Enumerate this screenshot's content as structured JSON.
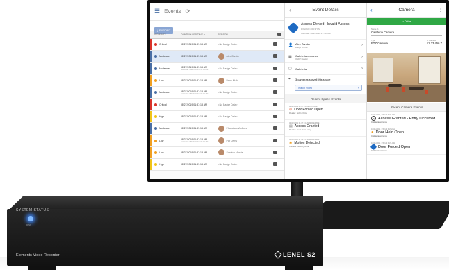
{
  "events_pane": {
    "title": "Events",
    "export_label": "EXPORT",
    "columns": [
      "SEVERITY",
      "CONTROLLER TIME",
      "PERSON",
      ""
    ],
    "rows": [
      {
        "severity": "Critical",
        "color": "#d9342b",
        "time": "08/27/2019 01:37:13 AM",
        "sub": "",
        "person": "<No Badge Data>",
        "avatar": false
      },
      {
        "severity": "Moderate",
        "color": "#4a6fa5",
        "time": "08/27/2019 01:37:13 AM",
        "sub": "",
        "person": "Alec Zander",
        "avatar": true
      },
      {
        "severity": "Moderate",
        "color": "#4a6fa5",
        "time": "08/27/2019 01:37:13 AM",
        "sub": "Controller: 08/27/2019 1:37:06 AM",
        "person": "<No Badge Data>",
        "avatar": false
      },
      {
        "severity": "Low",
        "color": "#f0a023",
        "time": "08/27/2019 01:37:13 AM",
        "sub": "",
        "person": "Brian Muth",
        "avatar": true
      },
      {
        "severity": "Moderate",
        "color": "#4a6fa5",
        "time": "08/27/2019 01:37:13 AM",
        "sub": "Controller: 08/27/2019 1:37:06 AM",
        "person": "<No Badge Data>",
        "avatar": false
      },
      {
        "severity": "Critical",
        "color": "#d9342b",
        "time": "08/27/2019 01:37:13 AM",
        "sub": "",
        "person": "<No Badge Data>",
        "avatar": false
      },
      {
        "severity": "High",
        "color": "#f0c419",
        "time": "08/27/2019 01:37:13 AM",
        "sub": "",
        "person": "<No Badge Data>",
        "avatar": false
      },
      {
        "severity": "Moderate",
        "color": "#4a6fa5",
        "time": "08/27/2019 01:37:13 AM",
        "sub": "",
        "person": "Ffrancisco Wolkonz",
        "avatar": true
      },
      {
        "severity": "Low",
        "color": "#f0a023",
        "time": "08/27/2019 01:37:13 AM",
        "sub": "Controller: 08/27/2019 1:37:06 AM",
        "person": "Pat Cerny",
        "avatar": true
      },
      {
        "severity": "Low",
        "color": "#f0a023",
        "time": "08/27/2019 01:37:13 AM",
        "sub": "",
        "person": "Sarwich Marcia",
        "avatar": true
      },
      {
        "severity": "High",
        "color": "#f0c419",
        "time": "08/27/2019 01:37:13 AM",
        "sub": "",
        "person": "<No Badge Data>",
        "avatar": false
      }
    ]
  },
  "details_pane": {
    "title": "Event Details",
    "event_name": "Access Denied - Invalid Access",
    "event_time": "1/28/2020 4:04:37 PM",
    "event_controller": "Controller: 08/27/2019 1:37:06 AM",
    "person_name": "Alec Zander",
    "person_badge": "Badge ID: 011",
    "reader_name": "Cafeteria entrance",
    "reader_type": "OSDP Reader",
    "space_name": "Cafeteria",
    "cameras_text": "3 cameras surveil this space",
    "watch_label": "Watch Video",
    "recent_title": "Recent Space Events",
    "recent": [
      {
        "meta": "08/27/2019 01:37:13 AM  CRITICAL",
        "name": "Door Forced Open",
        "reader": "Reader: Bob's Office",
        "icon": "red"
      },
      {
        "meta": "08/27/2019 01:37:13 AM  MODERATE",
        "name": "Access Granted",
        "reader": "Reader: Front Door Entry",
        "icon": "gray"
      },
      {
        "meta": "08/27/2019 01:37:13 AM  MODERATE",
        "name": "Motion Detected",
        "reader": "Camera: Delivery Area",
        "icon": "orange"
      }
    ]
  },
  "camera_pane": {
    "title": "Camera",
    "status": "Online",
    "name_label": "Name",
    "name_value": "Cafeteria Camera",
    "type_label": "Type",
    "type_value": "PTZ Camera",
    "ip_label": "IP Address",
    "ip_value": "12.23.456.7",
    "recent_title": "Recent Camera Events",
    "events": [
      {
        "meta": "10/21/2019, 1:50:23 PM  LOW",
        "name": "Access Granted - Entry Occurred",
        "reader": "Cafeteria entrance",
        "icon": "chevron"
      },
      {
        "meta": "10/21/2019, 1:50:23 PM  HIGH",
        "name": "Door Held Open",
        "reader": "Cafeteria entrance",
        "icon": "warn"
      },
      {
        "meta": "10/21/2019, 1:50:23 PM  LOW",
        "name": "Door Forced Open",
        "reader": "Cafeteria entrance",
        "icon": "blue"
      }
    ]
  },
  "hardware": {
    "status_label": "SYSTEM STATUS",
    "led_label": "DISK",
    "product_name": "Elements Video Recorder",
    "brand": "LENEL S2"
  }
}
